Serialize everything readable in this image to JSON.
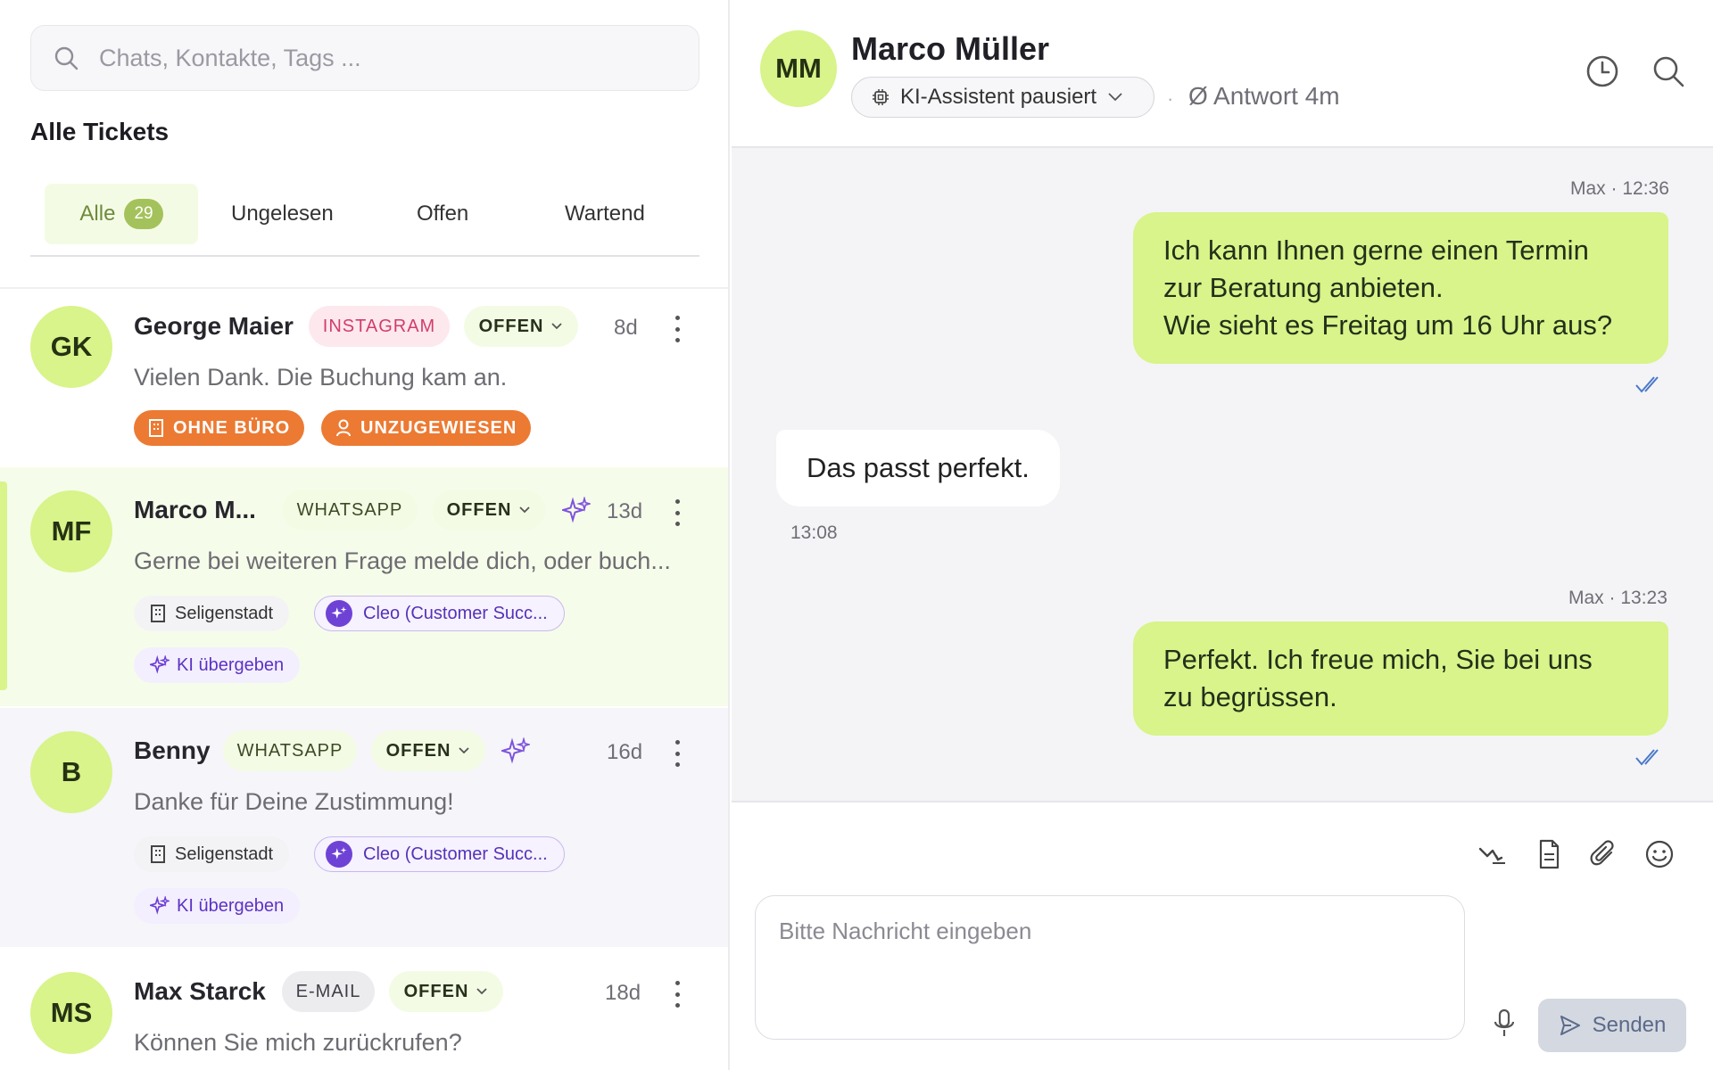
{
  "search": {
    "placeholder": "Chats, Kontakte, Tags ..."
  },
  "list": {
    "title": "Alle Tickets",
    "tabs": [
      {
        "label": "Alle",
        "count": "29"
      },
      {
        "label": "Ungelesen"
      },
      {
        "label": "Offen"
      },
      {
        "label": "Wartend"
      }
    ]
  },
  "tickets": [
    {
      "initials": "GK",
      "name": "George Maier",
      "channel": "INSTAGRAM",
      "status": "OFFEN",
      "age": "8d",
      "preview": "Vielen Dank. Die Buchung kam an.",
      "tags": [
        "OHNE BÜRO",
        "UNZUGEWIESEN"
      ]
    },
    {
      "initials": "MF",
      "name": "Marco M...",
      "channel": "WHATSAPP",
      "status": "OFFEN",
      "age": "13d",
      "preview": "Gerne bei weiteren Frage melde dich, oder buch...",
      "office": "Seligenstadt",
      "assignee": "Cleo (Customer Succ...",
      "ki": "KI übergeben"
    },
    {
      "initials": "B",
      "name": "Benny",
      "channel": "WHATSAPP",
      "status": "OFFEN",
      "age": "16d",
      "preview": "Danke für Deine Zustimmung!",
      "office": "Seligenstadt",
      "assignee": "Cleo (Customer Succ...",
      "ki": "KI übergeben"
    },
    {
      "initials": "MS",
      "name": "Max Starck",
      "channel": "E-MAIL",
      "status": "OFFEN",
      "age": "18d",
      "preview": "Können Sie mich zurückrufen?"
    }
  ],
  "chat": {
    "initials": "MM",
    "name": "Marco Müller",
    "ki_status": "KI-Assistent pausiert",
    "separator": "·",
    "response_time": "Ø Antwort 4m",
    "messages": [
      {
        "meta": "Max · 12:36",
        "lines": [
          "Ich kann Ihnen gerne einen Termin",
          "zur Beratung anbieten.",
          "Wie sieht es Freitag um 16 Uhr aus?"
        ]
      },
      {
        "meta": "13:08",
        "lines": [
          "Das passt perfekt."
        ]
      },
      {
        "meta": "Max · 13:23",
        "lines": [
          "Perfekt. Ich freue mich, Sie bei uns",
          "zu begrüssen."
        ]
      }
    ],
    "input_placeholder": "Bitte Nachricht eingeben",
    "send_label": "Senden"
  },
  "colors": {
    "accent": "#d8f48a",
    "ki_purple": "#6f42d6",
    "orange": "#ec7a33",
    "instagram": "#d23d6b"
  }
}
